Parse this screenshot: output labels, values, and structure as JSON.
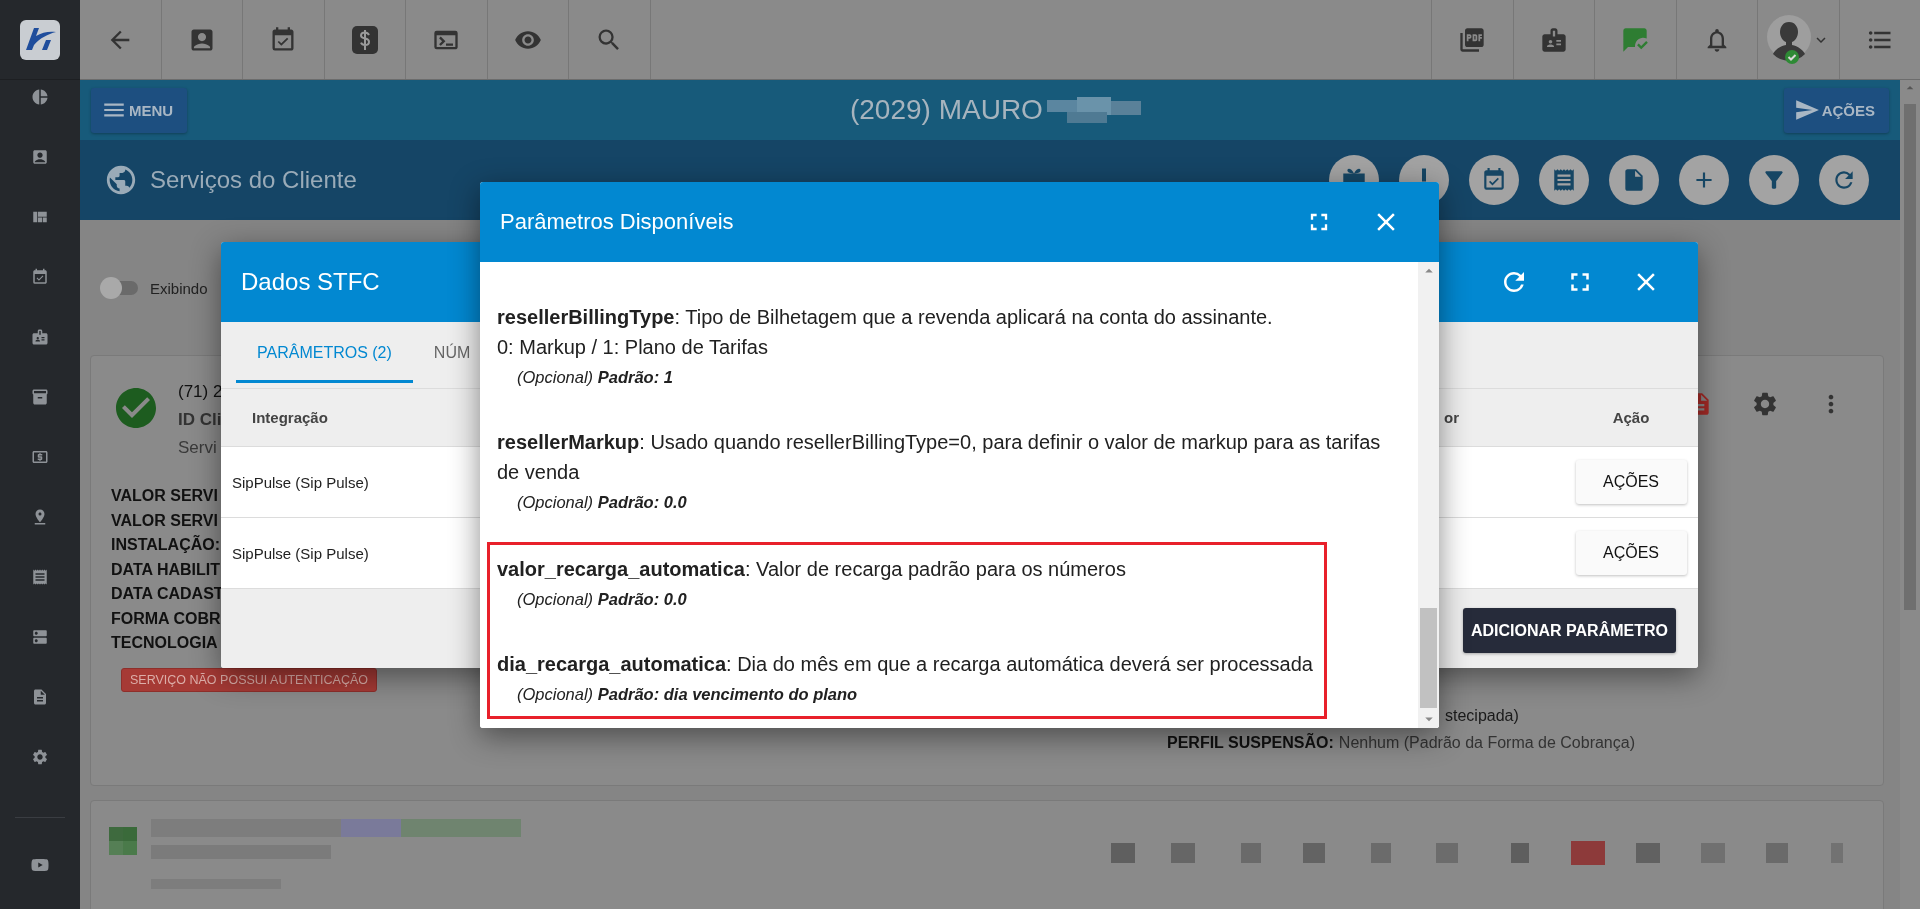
{
  "header": {
    "menu_button": "MENU",
    "title": "(2029) MAURO",
    "actions_button": "AÇÕES"
  },
  "page_header": {
    "title": "Serviços do Cliente"
  },
  "filter_toggle": {
    "label": "Exibindo",
    "on": false
  },
  "service_card": {
    "phone": "(71) 2",
    "id_line": "ID Cli",
    "service_line": "Servi",
    "fields": [
      "VALOR SERVI",
      "VALOR SERVI",
      "INSTALAÇÃO:",
      "DATA HABILIT",
      "DATA CADAST",
      "FORMA COBR",
      "TECNOLOGIA"
    ],
    "badge": "SERVIÇO NÃO POSSUI AUTENTICAÇÃO",
    "billing_tail": "stecipada)",
    "suspension": {
      "label": "PERFIL SUSPENSÃO:",
      "value": "Nenhum (Padrão da Forma de Cobrança)"
    }
  },
  "dados_dialog": {
    "title": "Dados STFC",
    "tabs": [
      {
        "label": "PARÂMETROS (2)",
        "selected": true
      },
      {
        "label": "NÚM",
        "selected": false
      }
    ],
    "columns": [
      "Integração",
      "or",
      "Ação"
    ],
    "rows": [
      {
        "integration": "SipPulse (Sip Pulse)",
        "action": "AÇÕES"
      },
      {
        "integration": "SipPulse (Sip Pulse)",
        "action": "AÇÕES"
      }
    ],
    "add_button": "ADICIONAR PARÂMETRO"
  },
  "params_dialog": {
    "title": "Parâmetros Disponíveis",
    "parameters": [
      {
        "text": "**resellerBillingType**: Tipo de Bilhetagem que a revenda aplicará na conta do assinante.\n0: Markup / 1: Plano de Tarifas",
        "note": "(Opcional) **Padrão: 1**",
        "highlighted": false
      },
      {
        "text": "**resellerMarkup**: Usado quando resellerBillingType=0, para definir o valor de markup para as tarifas de venda",
        "note": "(Opcional) **Padrão: 0.0**",
        "highlighted": false
      },
      {
        "text": "**valor_recarga_automatica**: Valor de recarga padrão para os números",
        "note": "(Opcional) **Padrão: 0.0**",
        "highlighted": true
      },
      {
        "text": "**dia_recarga_automatica**: Dia do mês em que a recarga automática deverá ser processada",
        "note": "(Opcional) **Padrão: dia vencimento do plano**",
        "highlighted": true
      }
    ]
  }
}
